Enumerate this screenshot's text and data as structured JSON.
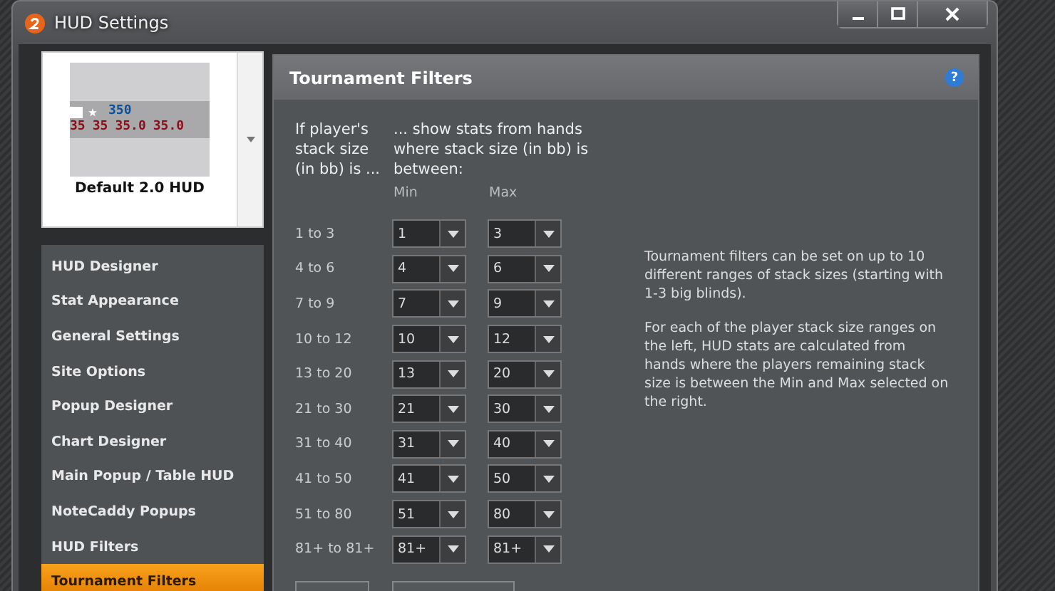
{
  "window": {
    "title": "HUD Settings"
  },
  "hud_preview": {
    "top_stat": "350",
    "stats": [
      "35",
      "35",
      "35.0",
      "35.0"
    ],
    "name": "Default 2.0 HUD"
  },
  "sidebar": {
    "items": [
      {
        "label": "HUD Designer",
        "selected": false
      },
      {
        "label": "Stat Appearance",
        "selected": false
      },
      {
        "label": "General Settings",
        "selected": false
      },
      {
        "label": "Site Options",
        "selected": false
      },
      {
        "label": "Popup Designer",
        "selected": false
      },
      {
        "label": "Chart Designer",
        "selected": false
      },
      {
        "label": "Main Popup / Table HUD",
        "selected": false
      },
      {
        "label": "NoteCaddy Popups",
        "selected": false
      },
      {
        "label": "HUD Filters",
        "selected": false
      },
      {
        "label": "Tournament Filters",
        "selected": true
      }
    ]
  },
  "panel": {
    "title": "Tournament Filters",
    "help_icon": "?",
    "left_heading": "If player's stack size (in bb) is ...",
    "right_heading": "... show stats from hands where stack size (in bb) is between:",
    "columns": [
      "Min",
      "Max"
    ],
    "rows": [
      {
        "label": "1 to 3",
        "min": "1",
        "max": "3"
      },
      {
        "label": "4 to 6",
        "min": "4",
        "max": "6"
      },
      {
        "label": "7 to 9",
        "min": "7",
        "max": "9"
      },
      {
        "label": "10 to 12",
        "min": "10",
        "max": "12"
      },
      {
        "label": "13 to 20",
        "min": "13",
        "max": "20"
      },
      {
        "label": "21 to 30",
        "min": "21",
        "max": "30"
      },
      {
        "label": "31 to 40",
        "min": "31",
        "max": "40"
      },
      {
        "label": "41 to 50",
        "min": "41",
        "max": "50"
      },
      {
        "label": "51 to 80",
        "min": "51",
        "max": "80"
      },
      {
        "label": "81+ to 81+",
        "min": "81+",
        "max": "81+"
      }
    ],
    "help": [
      "Tournament filters can be set on up to 10 different ranges of stack sizes (starting with 1-3 big blinds).",
      "For each of the player stack size ranges on the left, HUD stats are calculated from hands where the players remaining stack size is between the Min and Max selected on the right."
    ]
  }
}
